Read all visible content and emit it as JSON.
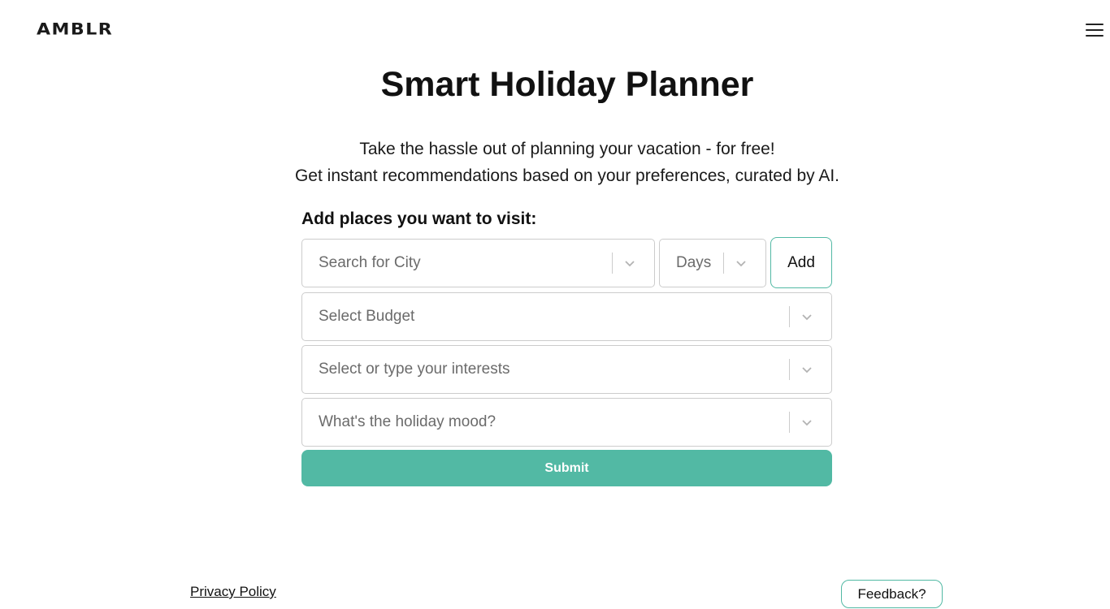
{
  "header": {
    "logo_text": "AMBLR",
    "menu_icon": "hamburger-menu-icon"
  },
  "hero": {
    "title": "Smart Holiday Planner",
    "subtitle_line1": "Take the hassle out of planning your vacation - for free!",
    "subtitle_line2": "Get instant recommendations based on your preferences, curated by AI."
  },
  "form": {
    "label": "Add places you want to visit:",
    "city": {
      "placeholder": "Search for City",
      "icon": "chevron-down-icon"
    },
    "days": {
      "placeholder": "Days",
      "icon": "chevron-down-icon"
    },
    "add_label": "Add",
    "budget": {
      "placeholder": "Select Budget",
      "icon": "chevron-down-icon"
    },
    "interests": {
      "placeholder": "Select or type your interests",
      "icon": "chevron-down-icon"
    },
    "mood": {
      "placeholder": "What's the holiday mood?",
      "icon": "chevron-down-icon"
    },
    "submit_label": "Submit"
  },
  "footer": {
    "privacy_label": "Privacy Policy",
    "feedback_label": "Feedback?"
  },
  "colors": {
    "accent": "#52b9a4",
    "border": "#cccccc",
    "placeholder": "#6b6b6b",
    "text": "#111111"
  }
}
